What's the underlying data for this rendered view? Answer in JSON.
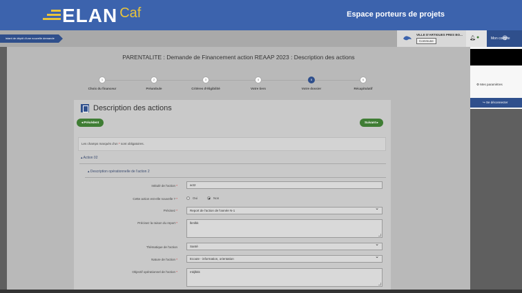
{
  "header": {
    "logo_elan": "ELAN",
    "logo_caf": "Caf",
    "title": "Espace porteurs de projets"
  },
  "breadcrumb": {
    "label": "istant de dépôt d'une nouvelle demande"
  },
  "user": {
    "name": "VILLE D'ARTIGUES PRES BO...",
    "badge": "Commune",
    "account_label": "Mon compte"
  },
  "dropdown": {
    "params_label": "Mes paramètres",
    "logout_label": "Se déconnecter"
  },
  "page": {
    "title": "PARENTALITE : Demande de Financement action REAAP 2023 : Description des actions"
  },
  "stepper": {
    "steps": [
      {
        "num": "1",
        "label": "Choix du financeur",
        "active": false
      },
      {
        "num": "2",
        "label": "Préambule",
        "active": false
      },
      {
        "num": "3",
        "label": "Critères d'éligibilité",
        "active": false
      },
      {
        "num": "4",
        "label": "Votre tiers",
        "active": false
      },
      {
        "num": "5",
        "label": "Votre dossier",
        "active": true
      },
      {
        "num": "6",
        "label": "Récapitulatif",
        "active": false
      }
    ]
  },
  "card": {
    "title": "Description des actions",
    "prev_label": "Précédent",
    "next_label": "Suivant",
    "info_before": "Les champs marqués d'un ",
    "info_star": "*",
    "info_after": " sont obligatoires.",
    "section_action": "Action 02",
    "section_description": "Description opérationnelle de l'action 2"
  },
  "form": {
    "intitule": {
      "label": "Intitulé de l'action",
      "value": "act2"
    },
    "nouvelle": {
      "label": "Cette action est-elle nouvelle ?",
      "opt_oui": "Oui",
      "opt_non": "Non",
      "selected": "Non"
    },
    "precisez": {
      "label": "Précisez",
      "value": "Report de l'action de l'année N-1"
    },
    "raison": {
      "label": "Précisez la raison du report",
      "value": "lkmlkk"
    },
    "thematique": {
      "label": "Thématique de l'action",
      "value": "Santé"
    },
    "nature": {
      "label": "Nature de l'action",
      "value": "Ecoute - information, orientation"
    },
    "objectif": {
      "label": "Objectif opérationnel de l'action",
      "value": "mkjlkkk"
    }
  },
  "colors": {
    "brand_blue": "#3c63ad",
    "dark_blue": "#2f4f8c",
    "green": "#3f7d34",
    "logo_yellow": "#e9c43b"
  }
}
